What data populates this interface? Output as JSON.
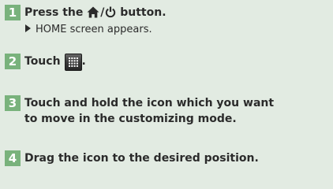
{
  "steps": [
    {
      "number": "1",
      "text": "Press the",
      "separator": "/",
      "suffix": "button.",
      "icons": [
        "home-icon",
        "power-icon"
      ]
    },
    {
      "number": "2",
      "text": "Touch",
      "suffix": ".",
      "icons": [
        "apps-grid-icon"
      ]
    },
    {
      "number": "3",
      "line1": "Touch and hold the icon which you want",
      "line2": "to move in the customizing mode."
    },
    {
      "number": "4",
      "text": "Drag the icon to the desired position."
    }
  ],
  "result": {
    "icon": "arrow-right-icon",
    "text": "HOME screen appears."
  },
  "colors": {
    "background": "#e2ebe2",
    "step_badge": "#79b27c",
    "text": "#2b2b2b"
  }
}
